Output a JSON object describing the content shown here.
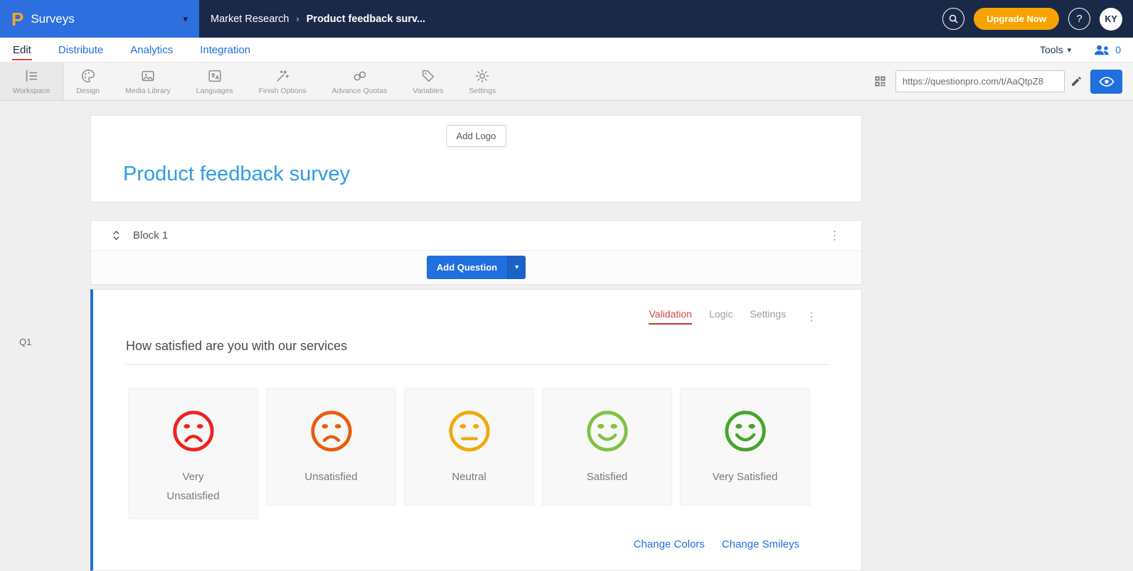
{
  "topbar": {
    "logo_glyph": "P",
    "product": "Surveys",
    "breadcrumb": {
      "parent": "Market Research",
      "separator": "›",
      "current": "Product feedback surv..."
    },
    "upgrade_label": "Upgrade Now",
    "help_label": "?",
    "avatar_initials": "KY"
  },
  "nav": {
    "tabs": [
      {
        "label": "Edit",
        "active": true
      },
      {
        "label": "Distribute",
        "active": false
      },
      {
        "label": "Analytics",
        "active": false
      },
      {
        "label": "Integration",
        "active": false
      }
    ],
    "tools_label": "Tools",
    "collaborators_count": "0"
  },
  "toolbar": {
    "items": [
      {
        "label": "Workspace",
        "icon": "workspace-icon",
        "active": true
      },
      {
        "label": "Design",
        "icon": "design-icon",
        "active": false
      },
      {
        "label": "Media Library",
        "icon": "media-library-icon",
        "active": false
      },
      {
        "label": "Languages",
        "icon": "languages-icon",
        "active": false
      },
      {
        "label": "Finish Options",
        "icon": "finish-options-icon",
        "active": false
      },
      {
        "label": "Advance Quotas",
        "icon": "advance-quotas-icon",
        "active": false
      },
      {
        "label": "Variables",
        "icon": "variables-icon",
        "active": false
      },
      {
        "label": "Settings",
        "icon": "settings-icon",
        "active": false
      }
    ],
    "survey_url": "https://questionpro.com/t/AaQtpZ8"
  },
  "survey": {
    "add_logo_label": "Add Logo",
    "title": "Product feedback survey",
    "block_name": "Block 1",
    "add_question_label": "Add Question",
    "add_question_caret": "▾"
  },
  "question": {
    "id_label": "Q1",
    "tabs": [
      {
        "label": "Validation",
        "active": true
      },
      {
        "label": "Logic",
        "active": false
      },
      {
        "label": "Settings",
        "active": false
      }
    ],
    "text": "How satisfied are you with our services",
    "options": [
      {
        "label": "Very Unsatisfied",
        "mood": "deep-frown",
        "color": "#ef2020"
      },
      {
        "label": "Unsatisfied",
        "mood": "frown",
        "color": "#e85d0c"
      },
      {
        "label": "Neutral",
        "mood": "neutral",
        "color": "#f0a80c"
      },
      {
        "label": "Satisfied",
        "mood": "smile",
        "color": "#7fc341"
      },
      {
        "label": "Very Satisfied",
        "mood": "big-smile",
        "color": "#44a62c"
      }
    ],
    "links": [
      {
        "label": "Change Colors"
      },
      {
        "label": "Change Smileys"
      }
    ]
  },
  "theme": {
    "topbar_navy": "#1b2949",
    "brand_blue": "#2e6fe0",
    "accent_blue": "#1f6fde",
    "active_red": "#e03e3e",
    "upgrade_orange": "#f7a400",
    "title_blue": "#2e9ce1"
  }
}
